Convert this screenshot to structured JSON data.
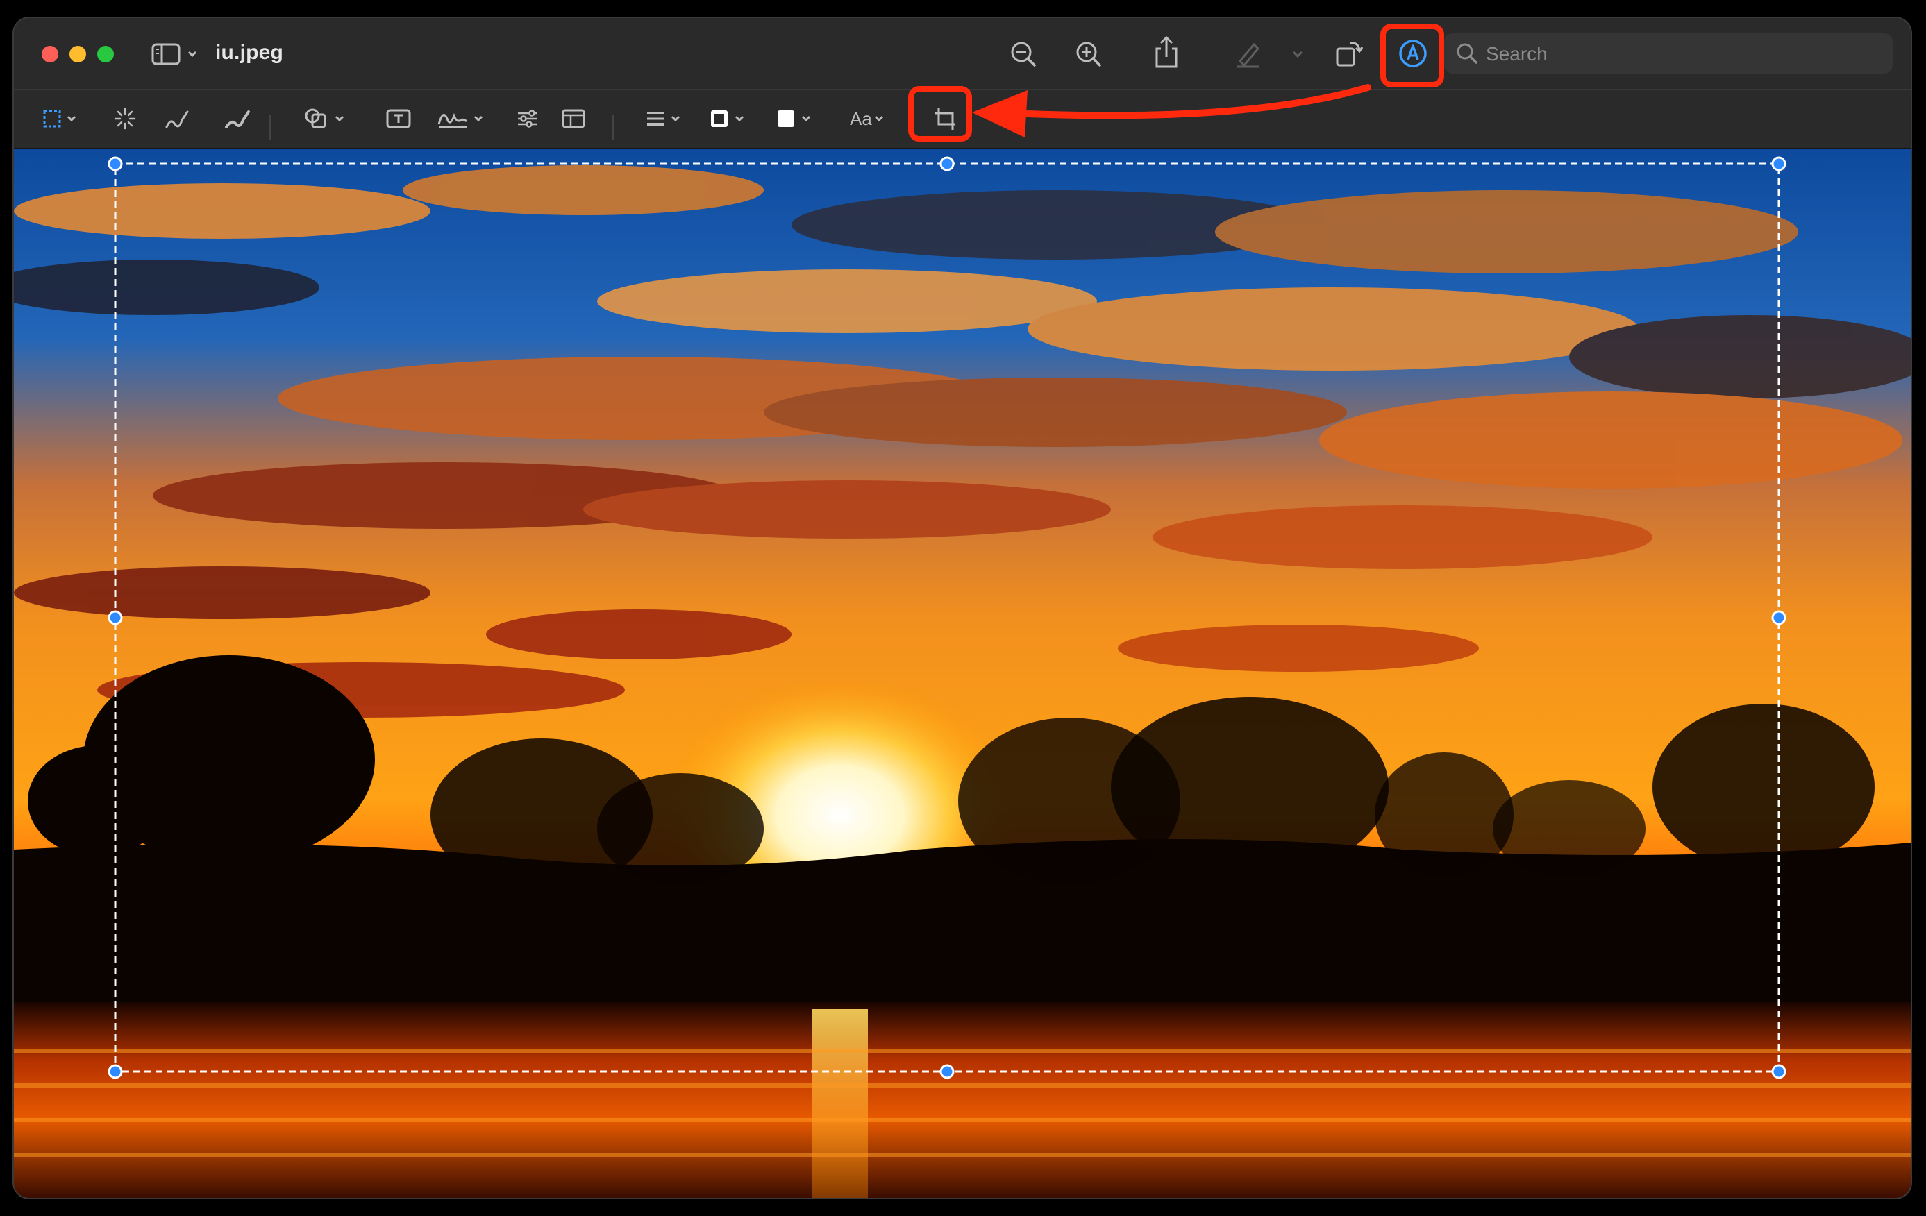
{
  "window": {
    "title": "iu.jpeg"
  },
  "search": {
    "placeholder": "Search"
  },
  "markup_toolbar": {
    "text_style_label": "Aa"
  },
  "colors": {
    "window_bg": "#262626",
    "accent_blue": "#3b9dff",
    "callout_red": "#ff2a0e",
    "close": "#ff5f57",
    "minimize": "#febc2e",
    "zoom": "#28c840"
  },
  "icons": {
    "titlebar": [
      "sidebar-icon",
      "zoom-out-icon",
      "zoom-in-icon",
      "share-icon",
      "highlight-pen-icon",
      "rotate-icon",
      "markup-icon",
      "search-icon"
    ],
    "markup": [
      "rectangular-selection-icon",
      "instant-alpha-icon",
      "sketch-icon",
      "draw-icon",
      "shapes-icon",
      "text-box-icon",
      "sign-icon",
      "adjust-color-icon",
      "page-layout-icon",
      "line-style-icon",
      "border-color-icon",
      "fill-color-icon",
      "text-style-icon",
      "crop-icon"
    ]
  }
}
